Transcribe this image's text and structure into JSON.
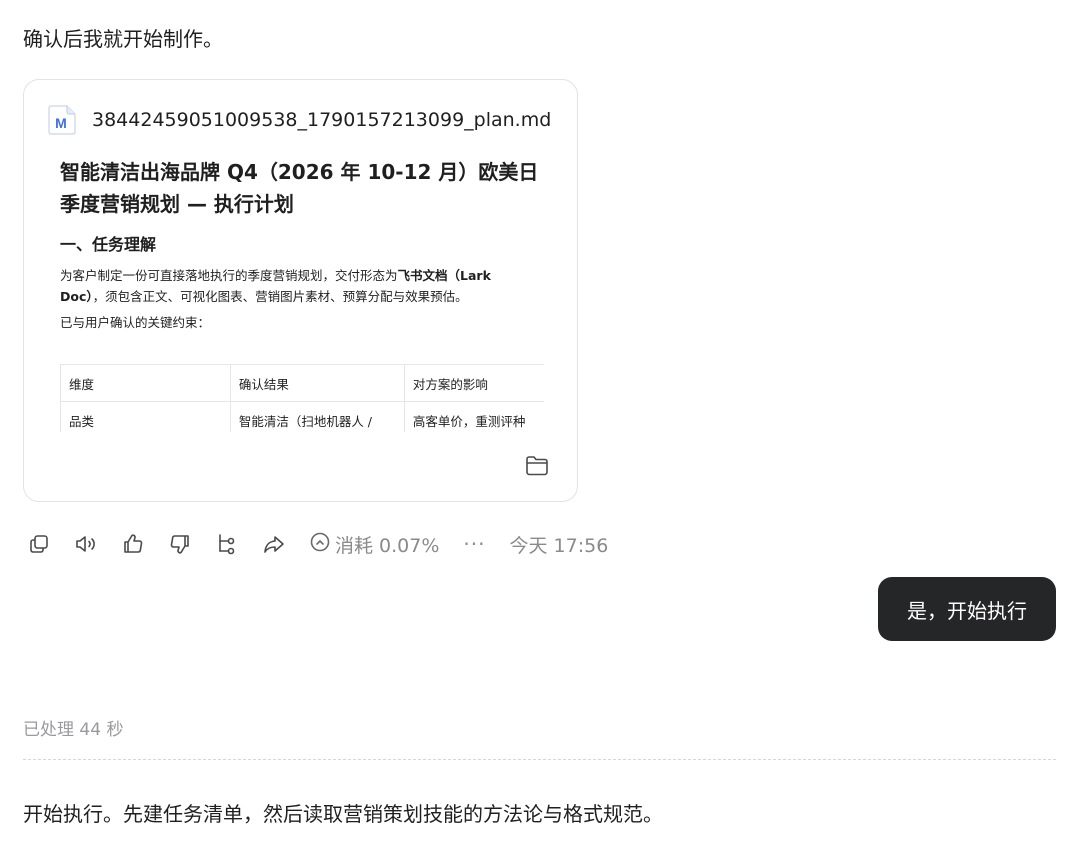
{
  "assistant_intro": "确认后我就开始制作。",
  "file_card": {
    "icon_letter": "M",
    "file_name": "38442459051009538_1790157213099_plan.md",
    "doc_title_line1": "智能清洁出海品牌 Q4（2026 年 10-12 月）欧美日",
    "doc_title_line2": "季度营销规划 — 执行计划",
    "section_heading": "一、任务理解",
    "para1_prefix": "为客户制定一份可直接落地执行的季度营销规划，交付形态为",
    "para1_bold1": "飞书文档（Lark",
    "para1_bold2": "Doc）",
    "para1_suffix": "，须包含正文、可视化图表、营销图片素材、预算分配与效果预估。",
    "para2": "已与用户确认的关键约束：",
    "table": {
      "headers": [
        "维度",
        "确认结果",
        "对方案的影响"
      ],
      "rows": [
        [
          "品类",
          "智能清洁（扫地机器人 /",
          "高客单价，重测评种"
        ]
      ]
    }
  },
  "toolbar": {
    "usage_label": "消耗 0.07%",
    "more_label": "···",
    "timestamp": "今天 17:56"
  },
  "user_message": "是，开始执行",
  "processed_label": "已处理 44 秒",
  "assistant_outro": "开始执行。先建任务清单，然后读取营销策划技能的方法论与格式规范。",
  "colors": {
    "bubble_bg": "#252627",
    "md_icon_blue": "#3f6fe0",
    "muted_text": "#8a8a8e"
  }
}
